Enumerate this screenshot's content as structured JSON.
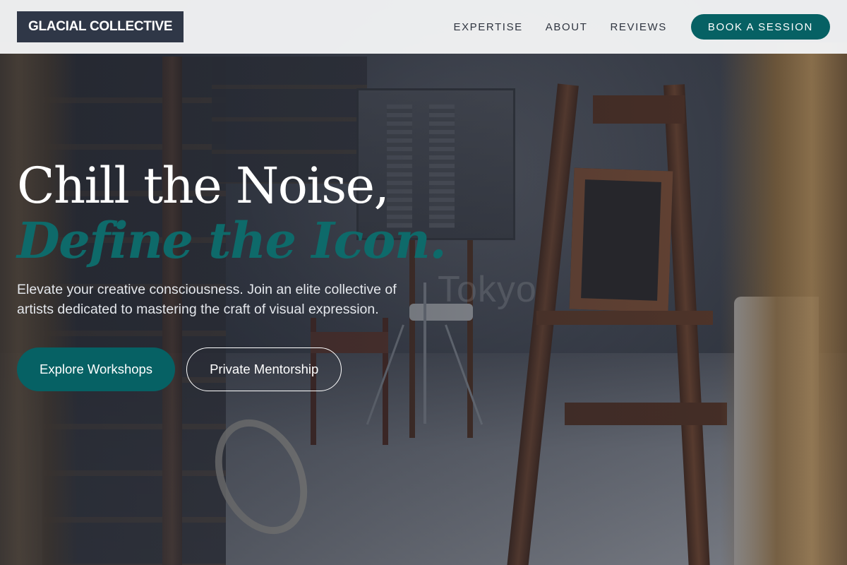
{
  "header": {
    "logo": "GLACIAL COLLECTIVE",
    "nav": [
      {
        "label": "EXPERTISE"
      },
      {
        "label": "ABOUT"
      },
      {
        "label": "REVIEWS"
      }
    ],
    "cta_label": "BOOK A SESSION"
  },
  "hero": {
    "headline_line1": "Chill the Noise,",
    "headline_line2": "Define the Icon.",
    "subtitle": "Elevate your creative consciousness. Join an elite collective of artists dedicated to mastering the craft of visual expression.",
    "primary_button": "Explore Workshops",
    "secondary_button": "Private Mentorship",
    "background_watermark": "Tokyo"
  },
  "colors": {
    "accent": "#066164",
    "logo_bg": "#2f3747",
    "header_bg": "#f2f3f4",
    "headline_accent": "#0e6a6a"
  }
}
